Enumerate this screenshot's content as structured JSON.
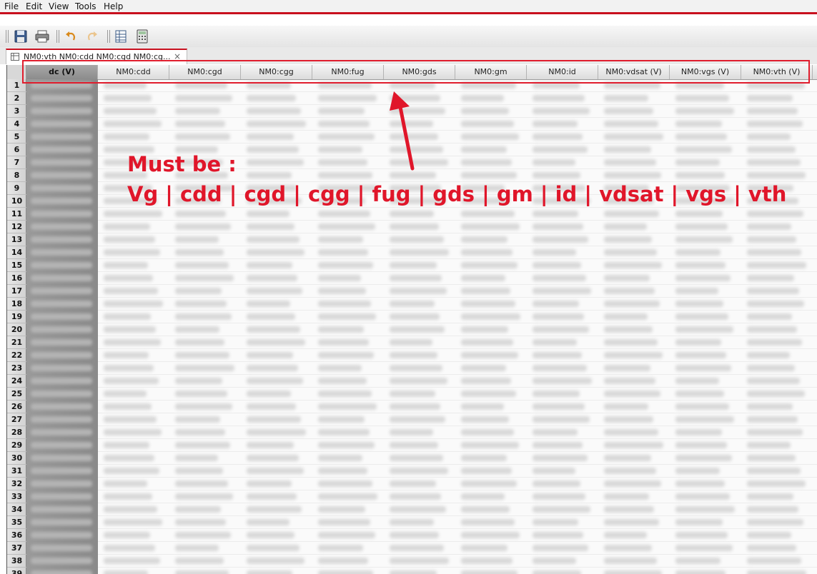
{
  "menu": {
    "file": "File",
    "edit": "Edit",
    "view": "View",
    "tools": "Tools",
    "help": "Help"
  },
  "toolbar": {
    "icons": [
      "save-icon",
      "print-icon",
      "undo-icon",
      "redo-icon",
      "table-view-icon",
      "calculator-icon"
    ]
  },
  "tab": {
    "label": "NM0:vth NM0:cdd NM0:cgd NM0:cg...",
    "close": "×"
  },
  "columns": [
    {
      "label": "dc (V)"
    },
    {
      "label": "NM0:cdd"
    },
    {
      "label": "NM0:cgd"
    },
    {
      "label": "NM0:cgg"
    },
    {
      "label": "NM0:fug"
    },
    {
      "label": "NM0:gds"
    },
    {
      "label": "NM0:gm"
    },
    {
      "label": "NM0:id"
    },
    {
      "label": "NM0:vdsat (V)"
    },
    {
      "label": "NM0:vgs (V)"
    },
    {
      "label": "NM0:vth (V)"
    }
  ],
  "rows": [
    "1",
    "2",
    "3",
    "4",
    "5",
    "6",
    "7",
    "8",
    "9",
    "10",
    "11",
    "12",
    "13",
    "14",
    "15",
    "16",
    "17",
    "18",
    "19",
    "20",
    "21",
    "22",
    "23",
    "24",
    "25",
    "26",
    "27",
    "28",
    "29",
    "30",
    "31",
    "32",
    "33",
    "34",
    "35",
    "36",
    "37",
    "38",
    "39"
  ],
  "annotation": {
    "line1": "Must be :",
    "line2": "Vg | cdd | cgd | cgg | fug | gds | gm | id | vdsat | vgs | vth"
  },
  "colors": {
    "accent": "#c8101e",
    "annotation": "#e0162a"
  }
}
